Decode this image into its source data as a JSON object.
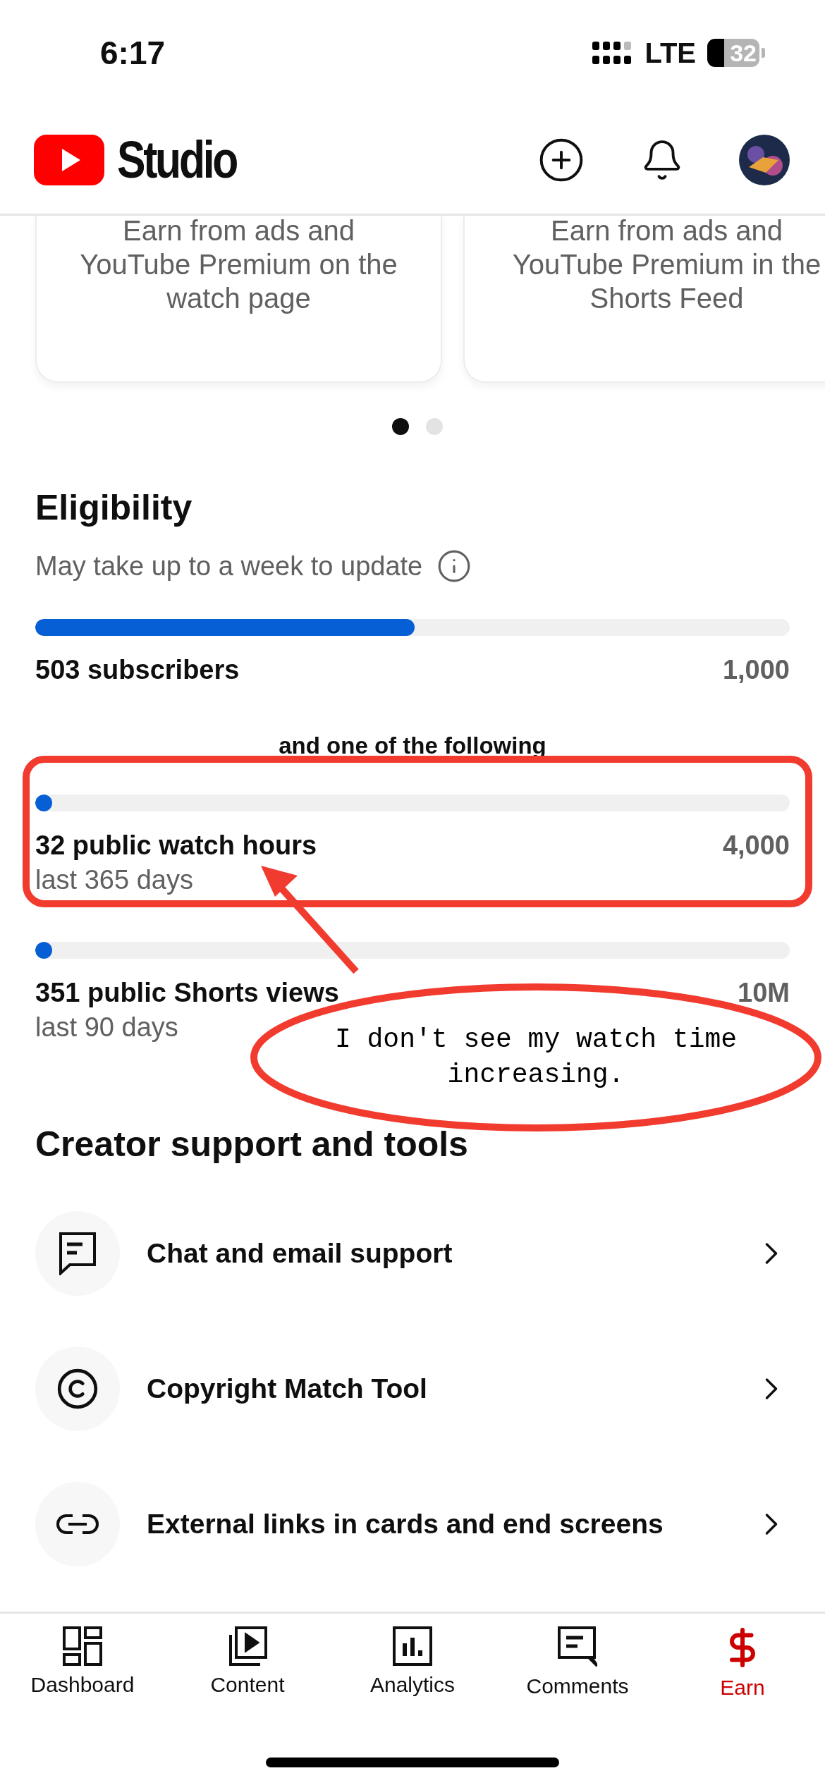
{
  "status_bar": {
    "time": "6:17",
    "network": "LTE",
    "battery": "32"
  },
  "header": {
    "logo": "Studio"
  },
  "feature_cards": [
    {
      "lines": [
        "Earn from ads and",
        "YouTube Premium on the",
        "watch page"
      ]
    },
    {
      "lines": [
        "Earn from ads and",
        "YouTube Premium in the",
        "Shorts Feed"
      ]
    }
  ],
  "pager": [
    {
      "selected": true
    },
    {
      "selected": false
    }
  ],
  "eligibility": {
    "title": "Eligibility",
    "note": "May take up to a week to update",
    "primary": {
      "label": "503 subscribers",
      "target": "1,000",
      "level": 0.503
    },
    "connector": "and one of the following",
    "requirements": [
      {
        "label": "32 public watch hours",
        "period": "last 365 days",
        "target": "4,000",
        "level": 0.008
      },
      {
        "label": "351 public Shorts views",
        "period": "last 90 days",
        "target": "10M",
        "level": 3.51e-05
      }
    ]
  },
  "support": {
    "title": "Creator support and tools",
    "items": [
      {
        "kind": "chat",
        "label": "Chat and email support"
      },
      {
        "kind": "copyright",
        "label": "Copyright Match Tool"
      },
      {
        "kind": "link",
        "label": "External links in cards and end screens"
      }
    ]
  },
  "annotation": {
    "note": "I don't see my watch time increasing."
  },
  "nav": [
    {
      "kind": "dashboard",
      "label": "Dashboard",
      "selected": false
    },
    {
      "kind": "content",
      "label": "Content",
      "selected": false
    },
    {
      "kind": "analytics",
      "label": "Analytics",
      "selected": false
    },
    {
      "kind": "comments",
      "label": "Comments",
      "selected": false
    },
    {
      "kind": "earn",
      "label": "Earn",
      "selected": true
    }
  ]
}
